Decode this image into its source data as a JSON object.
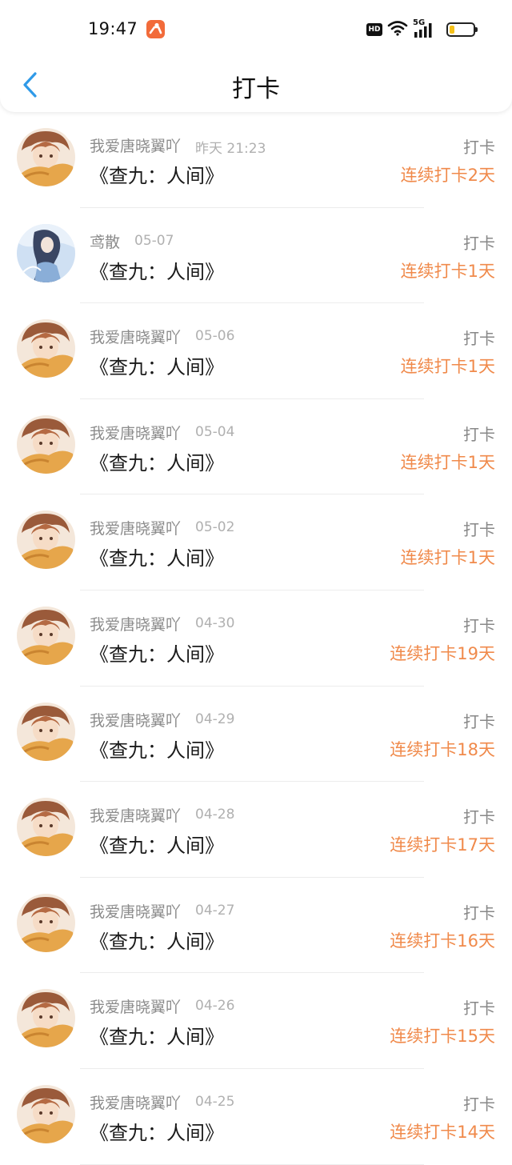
{
  "status_bar": {
    "time": "19:47",
    "hd_label": "HD",
    "network_label": "5G",
    "battery_level": 0.2,
    "battery_color": "#f6c21a",
    "app_badge_icon": "person-icon",
    "app_badge_color": "#f26b3a"
  },
  "nav": {
    "title": "打卡",
    "back_icon": "chevron-left-icon",
    "accent_color": "#2f9ae8"
  },
  "colors": {
    "streak": "#f08a4b",
    "name": "#8c8c8c",
    "time": "#b0b0b0",
    "book": "#1a1a1a",
    "action": "#888888"
  },
  "checkins": [
    {
      "user": "我爱唐晓翼吖",
      "time": "昨天 21:23",
      "book": "《查九：人间》",
      "action": "打卡",
      "streak": "连续打卡2天",
      "avatar": "avatar-orange"
    },
    {
      "user": "鸢散",
      "time": "05-07",
      "book": "《查九：人间》",
      "action": "打卡",
      "streak": "连续打卡1天",
      "avatar": "avatar-blue"
    },
    {
      "user": "我爱唐晓翼吖",
      "time": "05-06",
      "book": "《查九：人间》",
      "action": "打卡",
      "streak": "连续打卡1天",
      "avatar": "avatar-orange"
    },
    {
      "user": "我爱唐晓翼吖",
      "time": "05-04",
      "book": "《查九：人间》",
      "action": "打卡",
      "streak": "连续打卡1天",
      "avatar": "avatar-orange"
    },
    {
      "user": "我爱唐晓翼吖",
      "time": "05-02",
      "book": "《查九：人间》",
      "action": "打卡",
      "streak": "连续打卡1天",
      "avatar": "avatar-orange"
    },
    {
      "user": "我爱唐晓翼吖",
      "time": "04-30",
      "book": "《查九：人间》",
      "action": "打卡",
      "streak": "连续打卡19天",
      "avatar": "avatar-orange"
    },
    {
      "user": "我爱唐晓翼吖",
      "time": "04-29",
      "book": "《查九：人间》",
      "action": "打卡",
      "streak": "连续打卡18天",
      "avatar": "avatar-orange"
    },
    {
      "user": "我爱唐晓翼吖",
      "time": "04-28",
      "book": "《查九：人间》",
      "action": "打卡",
      "streak": "连续打卡17天",
      "avatar": "avatar-orange"
    },
    {
      "user": "我爱唐晓翼吖",
      "time": "04-27",
      "book": "《查九：人间》",
      "action": "打卡",
      "streak": "连续打卡16天",
      "avatar": "avatar-orange"
    },
    {
      "user": "我爱唐晓翼吖",
      "time": "04-26",
      "book": "《查九：人间》",
      "action": "打卡",
      "streak": "连续打卡15天",
      "avatar": "avatar-orange"
    },
    {
      "user": "我爱唐晓翼吖",
      "time": "04-25",
      "book": "《查九：人间》",
      "action": "打卡",
      "streak": "连续打卡14天",
      "avatar": "avatar-orange"
    }
  ]
}
